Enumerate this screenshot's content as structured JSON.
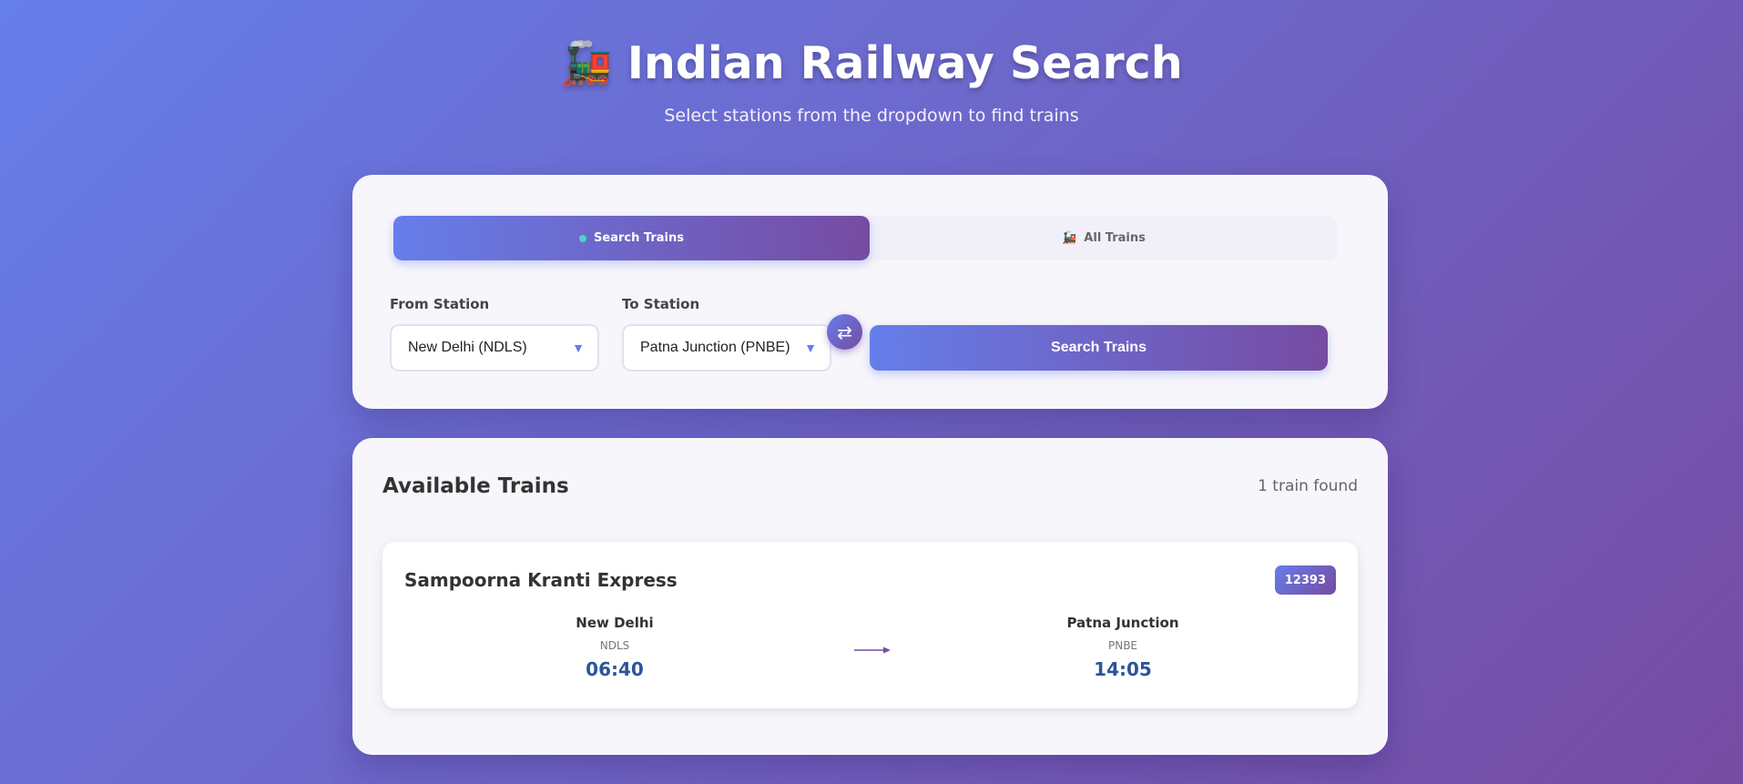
{
  "header": {
    "title": "Indian Railway Search",
    "title_icon": "🚂",
    "subtitle": "Select stations from the dropdown to find trains"
  },
  "tabs": [
    {
      "label": "Search Trains",
      "icon": "dot-icon",
      "active": true
    },
    {
      "label": "All Trains",
      "icon": "🚂",
      "active": false
    }
  ],
  "search": {
    "from_label": "From Station",
    "from_value": "New Delhi (NDLS)",
    "to_label": "To Station",
    "to_value": "Patna Junction (PNBE)",
    "swap_icon": "⇄",
    "button_label": "Search Trains"
  },
  "results": {
    "title": "Available Trains",
    "count": "1 train found",
    "trains": [
      {
        "name": "Sampoorna Kranti Express",
        "number": "12393",
        "from_name": "New Delhi",
        "from_code": "NDLS",
        "departure": "06:40",
        "to_name": "Patna Junction",
        "to_code": "PNBE",
        "arrival": "14:05"
      }
    ]
  },
  "colors": {
    "gradient_start": "#667eea",
    "gradient_end": "#764ba2",
    "time_color": "#2c5598",
    "dot_color": "#4fd1c5"
  }
}
